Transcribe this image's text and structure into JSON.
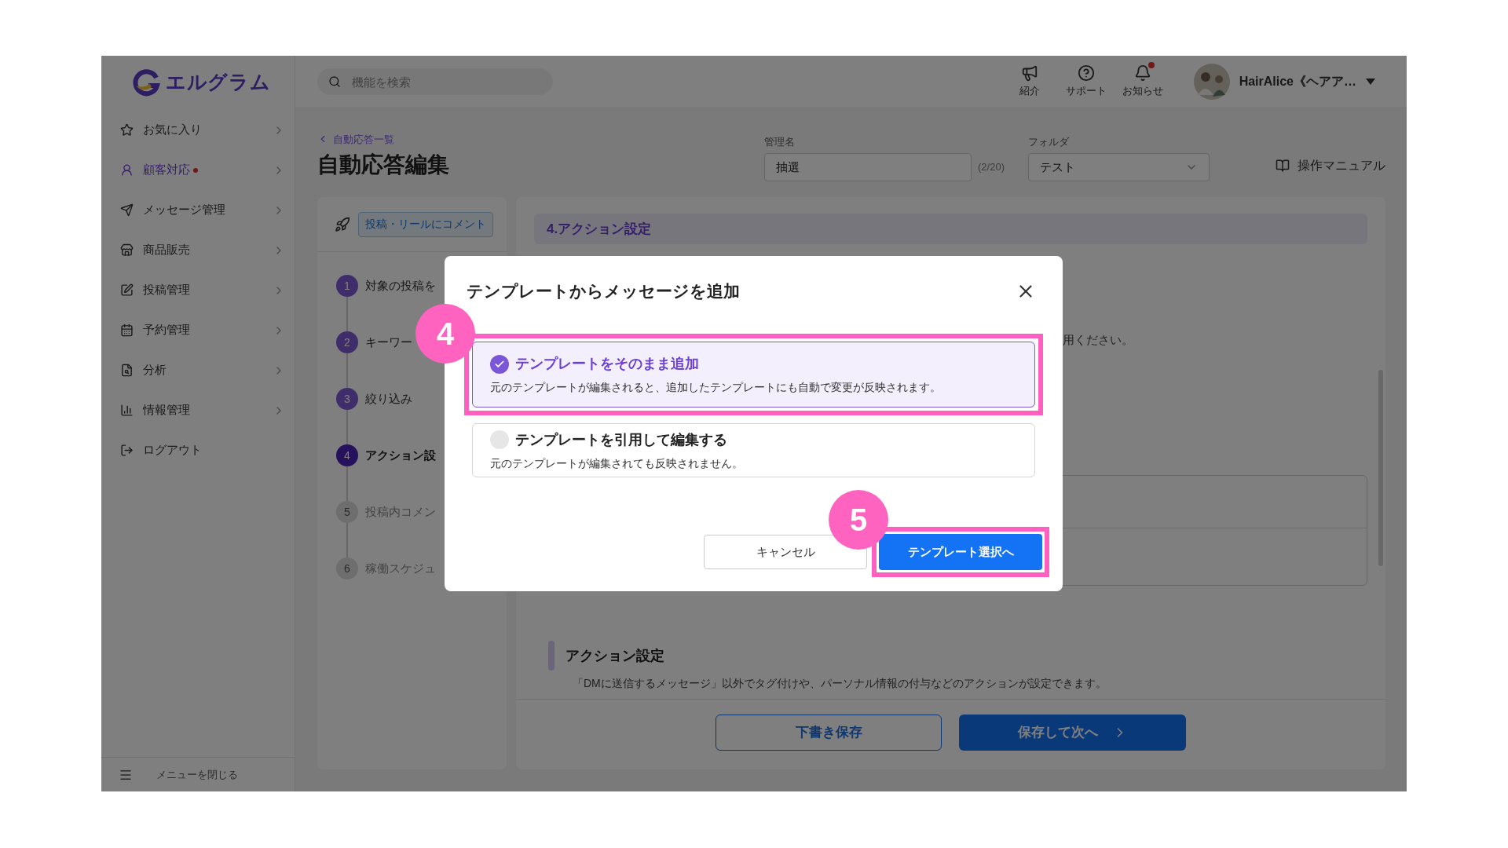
{
  "app": {
    "logo": "エルグラム"
  },
  "header": {
    "search_placeholder": "機能を検索",
    "actions": [
      {
        "label": "紹介",
        "kind": "megaphone",
        "badge": false
      },
      {
        "label": "サポート",
        "kind": "help",
        "badge": false
      },
      {
        "label": "お知らせ",
        "kind": "bell",
        "badge": true
      }
    ],
    "user": {
      "name": "HairAlice《ヘアア…"
    }
  },
  "sidebar": {
    "items": [
      {
        "label": "お気に入り",
        "kind": "star",
        "selected": false,
        "dot": false,
        "chevron": true
      },
      {
        "label": "顧客対応",
        "kind": "user",
        "selected": true,
        "dot": true,
        "chevron": true
      },
      {
        "label": "メッセージ管理",
        "kind": "send",
        "selected": false,
        "dot": false,
        "chevron": true
      },
      {
        "label": "商品販売",
        "kind": "store",
        "selected": false,
        "dot": false,
        "chevron": true
      },
      {
        "label": "投稿管理",
        "kind": "edit",
        "selected": false,
        "dot": false,
        "chevron": true
      },
      {
        "label": "予約管理",
        "kind": "calendar",
        "selected": false,
        "dot": false,
        "chevron": true
      },
      {
        "label": "分析",
        "kind": "report",
        "selected": false,
        "dot": false,
        "chevron": true
      },
      {
        "label": "情報管理",
        "kind": "chart",
        "selected": false,
        "dot": false,
        "chevron": true
      },
      {
        "label": "ログアウト",
        "kind": "logout",
        "selected": false,
        "dot": false,
        "chevron": false
      }
    ],
    "footer": "メニューを閉じる"
  },
  "page": {
    "breadcrumb": "自動応答一覧",
    "title": "自動応答編集",
    "name_field": {
      "label": "管理名",
      "value": "抽選",
      "counter": "(2/20)"
    },
    "folder_field": {
      "label": "フォルダ",
      "value": "テスト"
    },
    "manual": "操作マニュアル"
  },
  "steps_panel": {
    "trigger": "投稿・リールにコメント",
    "steps": [
      {
        "number": "1",
        "label": "対象の投稿を",
        "completed": true,
        "active": false
      },
      {
        "number": "2",
        "label": "キーワー",
        "completed": true,
        "active": false
      },
      {
        "number": "3",
        "label": "絞り込み",
        "completed": true,
        "active": false
      },
      {
        "number": "4",
        "label": "アクション設",
        "active": true
      },
      {
        "number": "5",
        "label": "投稿内コメン",
        "completed": false,
        "active": false
      },
      {
        "number": "6",
        "label": "稼働スケジュ",
        "completed": false,
        "active": false
      }
    ]
  },
  "content": {
    "section_header": "4.アクション設定",
    "partial_text": "用ください。",
    "action_section": {
      "title": "アクション設定",
      "description": "「DMに送信するメッセージ」以外でタグ付けや、パーソナル情報の付与などのアクションが設定できます。"
    },
    "draft_button": "下書き保存",
    "next_button": "保存して次へ"
  },
  "modal": {
    "title": "テンプレートからメッセージを追加",
    "options": [
      {
        "title": "テンプレートをそのまま追加",
        "description": "元のテンプレートが編集されると、追加したテンプレートにも自動で変更が反映されます。",
        "selected": true,
        "highlighted": true
      },
      {
        "title": "テンプレートを引用して編集する",
        "description": "元のテンプレートが編集されても反映されません。",
        "selected": false,
        "highlighted": false
      }
    ],
    "cancel": "キャンセル",
    "confirm": {
      "label": "テンプレート選択へ",
      "highlighted": true
    }
  },
  "callouts": [
    {
      "number": "4"
    },
    {
      "number": "5"
    }
  ]
}
